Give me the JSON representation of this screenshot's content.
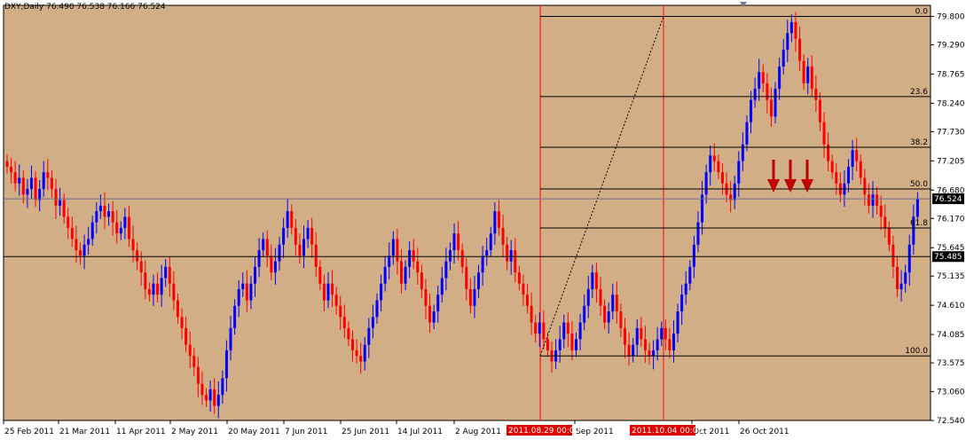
{
  "window": {
    "header": "DXY,Daily  76.490 76.538 76.166 76.524"
  },
  "colors": {
    "background": "#D2AE86",
    "bull": "#0000FF",
    "bear": "#FF0000",
    "grid": "#000000",
    "vline": "#FF0000",
    "fib": "#000000",
    "arrow": "#C00000",
    "current_label_bg": "#000000"
  },
  "chart_data": {
    "type": "candlestick",
    "symbol": "DXY",
    "timeframe": "Daily",
    "ohlc_current": {
      "open": 76.49,
      "high": 76.538,
      "low": 76.166,
      "close": 76.524
    },
    "y_ticks": [
      "79.800",
      "79.290",
      "78.765",
      "78.240",
      "77.730",
      "77.205",
      "76.680",
      "76.170",
      "75.645",
      "75.135",
      "74.610",
      "74.085",
      "73.575",
      "73.060",
      "72.540"
    ],
    "ylim": [
      72.54,
      80.0
    ],
    "x_ticks": [
      "25 Feb 2011",
      "21 Mar 2011",
      "11 Apr 2011",
      "2 May 2011",
      "20 May 2011",
      "7 Jun 2011",
      "25 Jun 2011",
      "14 Jul 2011",
      "2 Aug 2011",
      "Sep 2011",
      "Oct 2011",
      "26 Oct 2011"
    ],
    "vertical_markers": [
      "2011.08.29 00:00",
      "2011.10.04 00:00"
    ],
    "fib_levels": [
      {
        "label": "0.0",
        "price": 79.8
      },
      {
        "label": "23.6",
        "price": 78.36
      },
      {
        "label": "38.2",
        "price": 77.45
      },
      {
        "label": "50.0",
        "price": 76.7
      },
      {
        "label": "61.8",
        "price": 76.0
      },
      {
        "label": "100.0",
        "price": 73.7
      }
    ],
    "horizontal_lines": [
      {
        "label": "76.524",
        "price": 76.524
      },
      {
        "label": "75.485",
        "price": 75.485
      }
    ],
    "closes": [
      77.1,
      77.0,
      76.8,
      76.9,
      76.6,
      76.7,
      76.9,
      76.5,
      76.7,
      77.0,
      76.9,
      76.7,
      76.4,
      76.5,
      76.2,
      76.0,
      75.8,
      75.6,
      75.5,
      75.7,
      75.8,
      76.1,
      76.3,
      76.4,
      76.2,
      76.3,
      76.1,
      75.9,
      76.0,
      76.2,
      75.8,
      75.6,
      75.4,
      75.2,
      74.9,
      74.8,
      75.0,
      74.8,
      75.1,
      75.3,
      75.0,
      74.7,
      74.4,
      74.2,
      73.9,
      73.7,
      73.5,
      73.2,
      73.0,
      72.9,
      73.1,
      72.8,
      73.0,
      73.3,
      73.8,
      74.2,
      74.6,
      74.9,
      75.0,
      74.7,
      75.0,
      75.3,
      75.6,
      75.8,
      75.5,
      75.2,
      75.4,
      75.7,
      76.0,
      76.3,
      76.0,
      75.7,
      75.5,
      75.8,
      76.0,
      75.7,
      75.3,
      75.0,
      74.7,
      75.0,
      74.8,
      74.6,
      74.4,
      74.2,
      74.0,
      73.8,
      73.7,
      73.6,
      73.9,
      74.2,
      74.4,
      74.7,
      75.0,
      75.3,
      75.5,
      75.8,
      75.4,
      75.0,
      75.3,
      75.6,
      75.4,
      75.2,
      74.9,
      74.6,
      74.3,
      74.5,
      74.8,
      75.1,
      75.4,
      75.6,
      75.9,
      75.6,
      75.3,
      74.9,
      74.6,
      74.9,
      75.2,
      75.5,
      75.6,
      75.9,
      76.3,
      76.0,
      75.7,
      75.4,
      75.6,
      75.2,
      75.0,
      74.8,
      74.6,
      74.3,
      74.1,
      74.3,
      74.0,
      73.8,
      73.6,
      73.8,
      74.0,
      74.3,
      74.1,
      73.8,
      74.0,
      74.3,
      74.6,
      74.9,
      75.2,
      74.9,
      74.6,
      74.3,
      74.5,
      74.8,
      74.5,
      74.2,
      73.9,
      73.7,
      73.9,
      74.2,
      74.0,
      73.8,
      73.7,
      73.8,
      74.0,
      74.2,
      74.0,
      73.8,
      74.1,
      74.5,
      74.8,
      75.0,
      75.3,
      75.7,
      76.1,
      76.6,
      77.0,
      77.3,
      77.2,
      77.0,
      76.8,
      76.6,
      76.5,
      76.8,
      77.2,
      77.5,
      77.9,
      78.3,
      78.5,
      78.8,
      78.6,
      78.3,
      78.0,
      78.5,
      78.9,
      79.2,
      79.5,
      79.7,
      79.4,
      79.0,
      78.6,
      78.9,
      78.5,
      78.3,
      77.9,
      77.5,
      77.2,
      77.0,
      76.8,
      76.6,
      76.8,
      77.1,
      77.4,
      77.2,
      76.9,
      76.6,
      76.4,
      76.6,
      76.4,
      76.2,
      76.0,
      75.7,
      75.3,
      74.9,
      75.0,
      75.2,
      75.7,
      76.2,
      76.524
    ],
    "annotations": [
      "three red arrows pointing down near 50.0 level"
    ]
  }
}
